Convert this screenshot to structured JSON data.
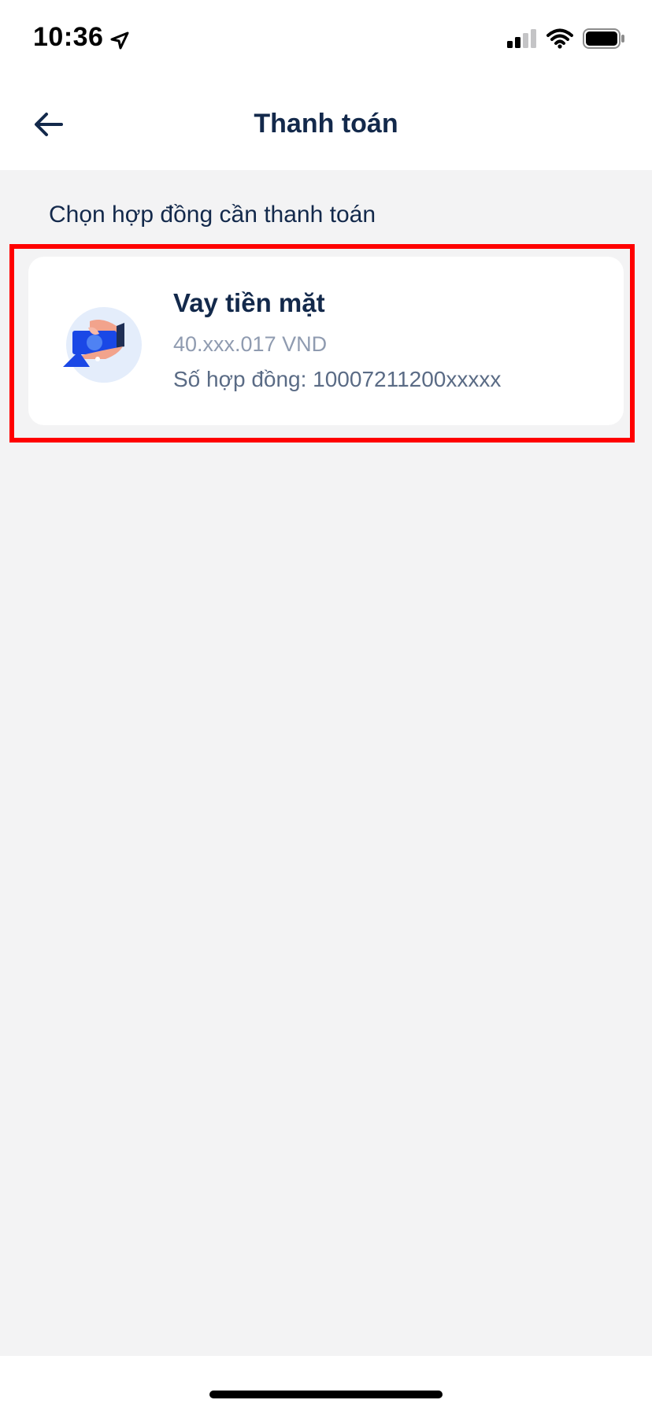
{
  "status_bar": {
    "time": "10:36",
    "location_icon": "location-arrow-icon",
    "signal_icon": "cellular-signal-icon",
    "wifi_icon": "wifi-icon",
    "battery_icon": "battery-icon"
  },
  "header": {
    "title": "Thanh toán",
    "back_icon": "arrow-left-icon"
  },
  "section": {
    "label": "Chọn hợp đồng cần thanh toán"
  },
  "contracts": [
    {
      "icon": "cash-loan-icon",
      "title": "Vay tiền mặt",
      "amount": "40.xxx.017 VND",
      "contract_number": "Số hợp đồng: 10007211200xxxxx"
    }
  ],
  "colors": {
    "primary_text": "#13294b",
    "highlight_border": "#ff0000",
    "background": "#f3f3f4",
    "icon_blue": "#1a48e6"
  }
}
